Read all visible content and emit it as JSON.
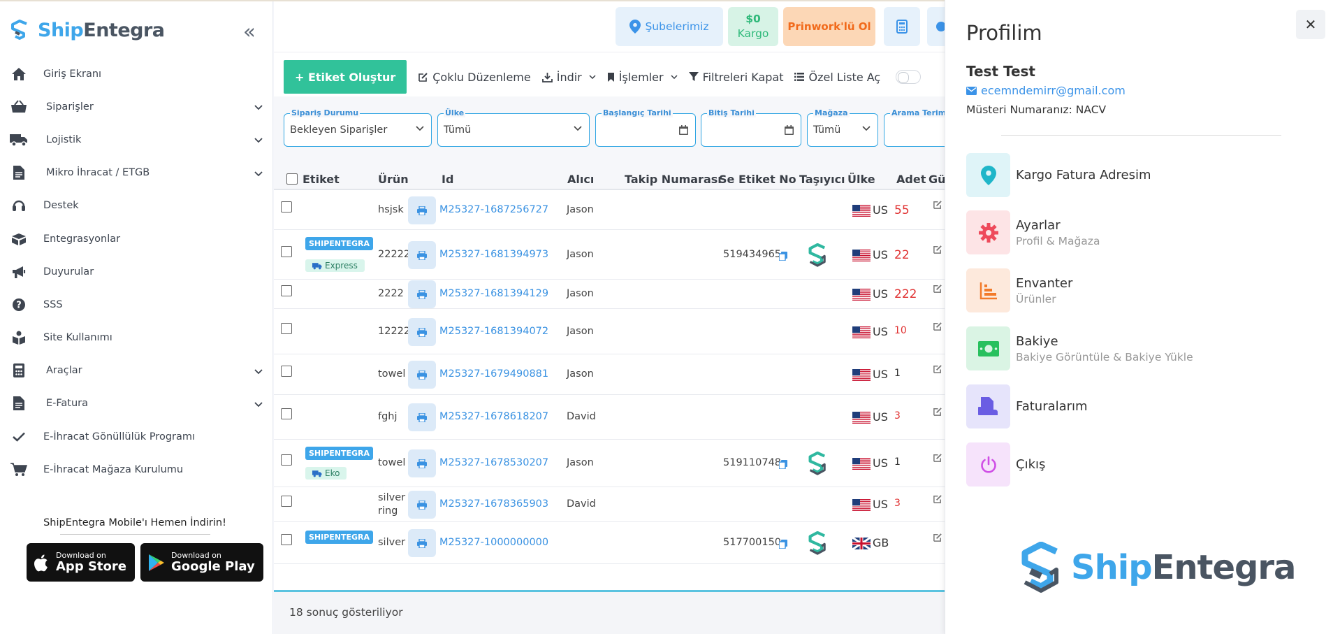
{
  "brand": {
    "name_a": "Ship",
    "name_b": "Entegra"
  },
  "sidebar": {
    "items": [
      {
        "label": "Giriş Ekranı",
        "icon": "home-icon",
        "chevron": false
      },
      {
        "label": "Siparişler",
        "icon": "basket-icon",
        "chevron": true
      },
      {
        "label": "Lojistik",
        "icon": "truck-icon",
        "chevron": true
      },
      {
        "label": "Mikro İhracat / ETGB",
        "icon": "document-icon",
        "chevron": true
      },
      {
        "label": "Destek",
        "icon": "headset-icon",
        "chevron": false
      },
      {
        "label": "Entegrasyonlar",
        "icon": "boxes-icon",
        "chevron": false
      },
      {
        "label": "Duyurular",
        "icon": "megaphone-icon",
        "chevron": false
      },
      {
        "label": "SSS",
        "icon": "question-icon",
        "chevron": false
      },
      {
        "label": "Site Kullanımı",
        "icon": "book-reader-icon",
        "chevron": false
      },
      {
        "label": "Araçlar",
        "icon": "calculator-icon",
        "chevron": true
      },
      {
        "label": "E-Fatura",
        "icon": "invoice-icon",
        "chevron": true
      },
      {
        "label": "E-İhracat Gönüllülük Programı",
        "icon": "check-icon",
        "chevron": false
      },
      {
        "label": "E-İhracat Mağaza Kurulumu",
        "icon": "cart-icon",
        "chevron": false
      }
    ],
    "mobile_title": "ShipEntegra Mobile'ı Hemen İndirin!",
    "app_store": {
      "small": "Download on",
      "big": "App Store"
    },
    "google_play": {
      "small": "Download on",
      "big": "Google Play"
    }
  },
  "topbar": {
    "branches": "Şubelerimiz",
    "cargo_amount": "$0",
    "cargo_label": "Kargo",
    "prinwork": "Prinwork'lü Ol"
  },
  "toolbar": {
    "create_label": "+ Etiket Oluştur",
    "bulk_edit": "Çoklu Düzenleme",
    "download": "İndir",
    "actions": "İşlemler",
    "close_filters": "Filtreleri Kapat",
    "custom_list": "Özel Liste Aç"
  },
  "filters": {
    "status": {
      "label": "Sipariş Durumu",
      "value": "Bekleyen Siparişler"
    },
    "country": {
      "label": "Ülke",
      "value": "Tümü"
    },
    "start_date": {
      "label": "Başlangıç Tarihi",
      "value": ""
    },
    "end_date": {
      "label": "Bitiş Tarihi",
      "value": ""
    },
    "store": {
      "label": "Mağaza",
      "value": "Tümü"
    },
    "search": {
      "label": "Arama Terim",
      "value": ""
    }
  },
  "table": {
    "headers": {
      "label": "Etiket",
      "product": "Ürün",
      "id": "Id",
      "recipient": "Alıcı",
      "tracking": "Takip Numarası",
      "se_label": "Se Etiket No",
      "carrier": "Taşıyıcı",
      "country": "Ülke",
      "qty": "Adet",
      "extra": "Gü"
    },
    "rows": [
      {
        "product": "hsjsk",
        "id": "M25327-1687256727",
        "recipient": "Jason",
        "se": "",
        "country": "US",
        "qty": "55",
        "tag": "",
        "service": ""
      },
      {
        "product": "22222",
        "id": "M25327-1681394973",
        "recipient": "Jason",
        "se": "519434965",
        "country": "US",
        "qty": "22",
        "tag": "SHIPENTEGRA",
        "service": "Express"
      },
      {
        "product": "2222",
        "id": "M25327-1681394129",
        "recipient": "Jason",
        "se": "",
        "country": "US",
        "qty": "222",
        "tag": "",
        "service": ""
      },
      {
        "product": "12222",
        "id": "M25327-1681394072",
        "recipient": "Jason",
        "se": "",
        "country": "US",
        "qty": "10",
        "tag": "",
        "service": ""
      },
      {
        "product": "towel",
        "id": "M25327-1679490881",
        "recipient": "Jason",
        "se": "",
        "country": "US",
        "qty": "1",
        "tag": "",
        "service": ""
      },
      {
        "product": "fghj",
        "id": "M25327-1678618207",
        "recipient": "David",
        "se": "",
        "country": "US",
        "qty": "3",
        "tag": "",
        "service": ""
      },
      {
        "product": "towel",
        "id": "M25327-1678530207",
        "recipient": "Jason",
        "se": "519110748",
        "country": "US",
        "qty": "1",
        "tag": "SHIPENTEGRA",
        "service": "Eko"
      },
      {
        "product": "silver ring",
        "id": "M25327-1678365903",
        "recipient": "David",
        "se": "",
        "country": "US",
        "qty": "3",
        "tag": "",
        "service": ""
      },
      {
        "product": "silver",
        "id": "M25327-1000000000",
        "recipient": "",
        "se": "517700150",
        "country": "GB",
        "qty": "",
        "tag": "SHIPENTEGRA",
        "service": ""
      }
    ],
    "footer": "18 sonuç gösteriliyor"
  },
  "profile": {
    "title": "Profilim",
    "name": "Test Test",
    "email": "ecemndemirr@gmail.com",
    "customer_no": "Müsteri Numaranız: NACV",
    "items": [
      {
        "title": "Kargo Fatura Adresim",
        "sub": "",
        "icon": "location-pin-icon",
        "bg": "#dff4f8",
        "fg": "#1fb6c9"
      },
      {
        "title": "Ayarlar",
        "sub": "Profil & Mağaza",
        "icon": "gear-icon",
        "bg": "#fde4e6",
        "fg": "#ee4a5b"
      },
      {
        "title": "Envanter",
        "sub": "Ürünler",
        "icon": "inventory-icon",
        "bg": "#fde9dc",
        "fg": "#f27a2a"
      },
      {
        "title": "Bakiye",
        "sub": "Bakiye Görüntüle & Bakiye Yükle",
        "icon": "money-icon",
        "bg": "#daf4e4",
        "fg": "#28c05e"
      },
      {
        "title": "Faturalarım",
        "sub": "",
        "icon": "invoice-icon",
        "bg": "#e6e4fb",
        "fg": "#6a5de3"
      },
      {
        "title": "Çıkış",
        "sub": "",
        "icon": "power-icon",
        "bg": "#f6e3fb",
        "fg": "#cf4fe6"
      }
    ],
    "logo_a": "Ship",
    "logo_b": "Entegra"
  },
  "colors": {
    "accent": "#3ea6ea",
    "primary_button": "#31c29a",
    "danger": "#e03131"
  }
}
